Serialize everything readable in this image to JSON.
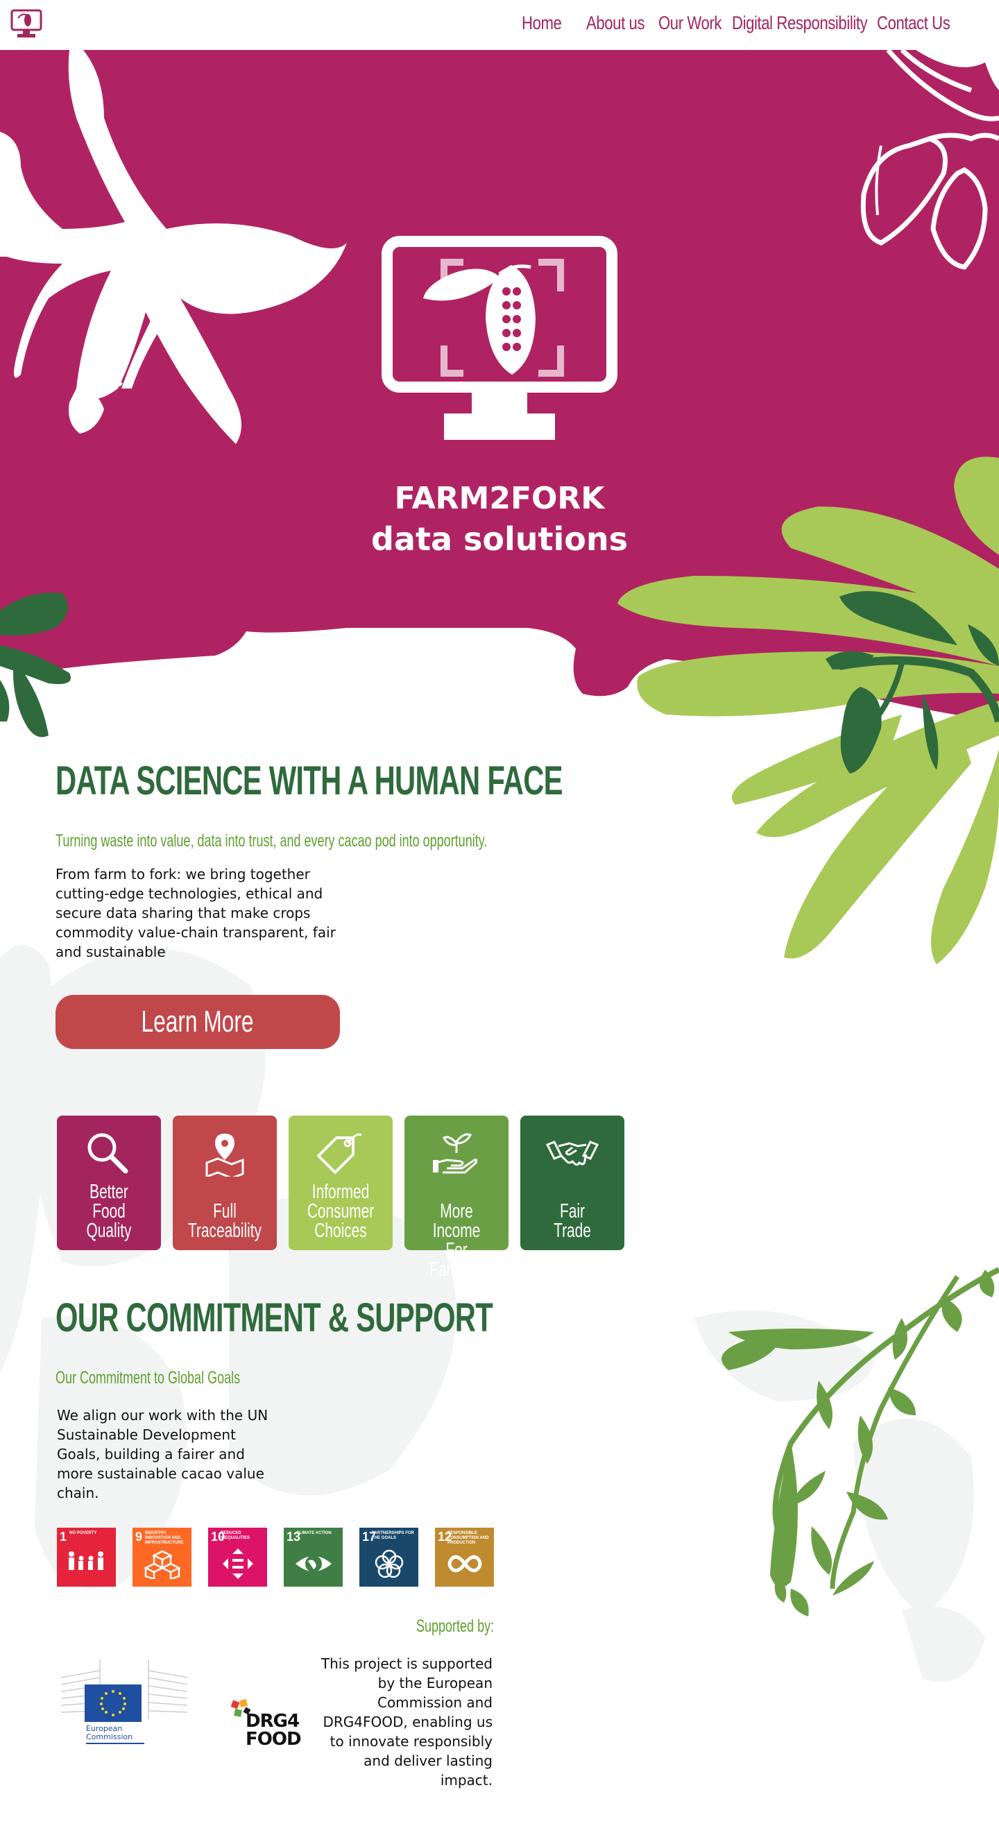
{
  "nav": {
    "links": [
      {
        "label": "Home"
      },
      {
        "label": "About us"
      },
      {
        "label": "Our Work"
      },
      {
        "label": "Digital Responsibility"
      },
      {
        "label": "Contact Us"
      }
    ]
  },
  "hero": {
    "title_line1": "FARM2FORK",
    "title_line2": "data solutions"
  },
  "intro": {
    "heading": "DATA SCIENCE WITH A HUMAN FACE",
    "subheading": "Turning waste into value, data into trust, and every cacao pod into opportunity.",
    "body": [
      "From farm to fork: we bring together",
      "cutting-edge technologies, ethical and",
      "secure data sharing that make crops",
      "commodity value-chain transparent, fair",
      "and sustainable"
    ],
    "cta_label": "Learn More"
  },
  "features": [
    {
      "label": "Better\nFood\nQuality",
      "icon": "magnifier-icon",
      "color": "#a3255d"
    },
    {
      "label": "Full\nTraceability",
      "icon": "map-pin-icon",
      "color": "#c0474a"
    },
    {
      "label": "Informed\nConsumer\nChoices",
      "icon": "price-tag-icon",
      "color": "#a8c957"
    },
    {
      "label": "More Income\nFor Farmers",
      "icon": "hand-sprout-icon",
      "color": "#6b9f45"
    },
    {
      "label": "Fair\nTrade",
      "icon": "handshake-icon",
      "color": "#2f6a3c"
    }
  ],
  "commitment": {
    "heading": "OUR COMMITMENT & SUPPORT",
    "subheading": "Our Commitment to Global Goals",
    "body": [
      "We align our work with the UN",
      "Sustainable Development",
      "Goals, building a fairer and",
      "more sustainable cacao value",
      "chain."
    ]
  },
  "sdgs": [
    {
      "number": "1",
      "title": "NO POVERTY",
      "color": "#e5243b",
      "icon": "family-icon"
    },
    {
      "number": "9",
      "title": "INDUSTRY, INNOVATION AND INFRASTRUCTURE",
      "color": "#fd6925",
      "icon": "cubes-icon"
    },
    {
      "number": "10",
      "title": "REDUCED INEQUALITIES",
      "color": "#dd1367",
      "icon": "equality-icon"
    },
    {
      "number": "13",
      "title": "CLIMATE ACTION",
      "color": "#3f7e44",
      "icon": "eye-globe-icon"
    },
    {
      "number": "17",
      "title": "PARTNERSHIPS FOR THE GOALS",
      "color": "#19486a",
      "icon": "rings-icon"
    },
    {
      "number": "12",
      "title": "RESPONSIBLE CONSUMPTION AND PRODUCTION",
      "color": "#bf8b2e",
      "icon": "infinity-icon"
    }
  ],
  "support": {
    "heading": "Supported by:",
    "eu_logo_text": "European Commission",
    "drg_logo_text": "DRG4 FOOD",
    "body": [
      "This project is supported",
      "by the European",
      "Commission and",
      "DRG4FOOD, enabling us",
      "to innovate responsibly",
      "and deliver lasting",
      "impact."
    ]
  }
}
